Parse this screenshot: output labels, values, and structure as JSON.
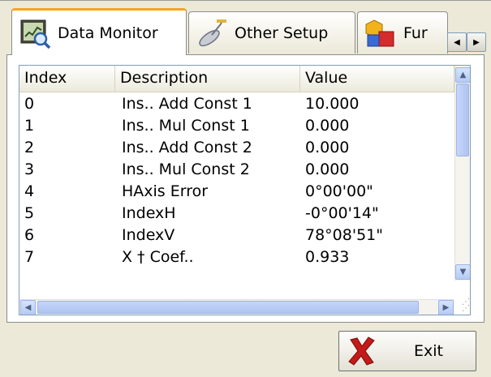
{
  "tabs": [
    {
      "label": "Data Monitor",
      "icon": "data-monitor-icon",
      "active": true
    },
    {
      "label": "Other Setup",
      "icon": "satellite-icon",
      "active": false
    },
    {
      "label": "Fur",
      "icon": "shapes-icon",
      "active": false
    }
  ],
  "table": {
    "columns": [
      "Index",
      "Description",
      "Value"
    ],
    "rows": [
      {
        "index": "0",
        "description": "Ins.. Add Const 1",
        "value": "10.000"
      },
      {
        "index": "1",
        "description": "Ins.. Mul Const 1",
        "value": "0.000"
      },
      {
        "index": "2",
        "description": "Ins.. Add Const 2",
        "value": "0.000"
      },
      {
        "index": "3",
        "description": "Ins.. Mul Const 2",
        "value": "0.000"
      },
      {
        "index": "4",
        "description": "HAxis Error",
        "value": "0°00'00\""
      },
      {
        "index": "5",
        "description": "IndexH",
        "value": "-0°00'14\""
      },
      {
        "index": "6",
        "description": "IndexV",
        "value": "78°08'51\""
      },
      {
        "index": "7",
        "description": "X † Coef..",
        "value": "0.933"
      }
    ]
  },
  "exit_button": {
    "label": "Exit",
    "icon": "red-x-icon"
  },
  "colors": {
    "accent_tab": "#f5a623",
    "scrollbar": "#b5cbf4",
    "exit_icon": "#c21a1a"
  }
}
